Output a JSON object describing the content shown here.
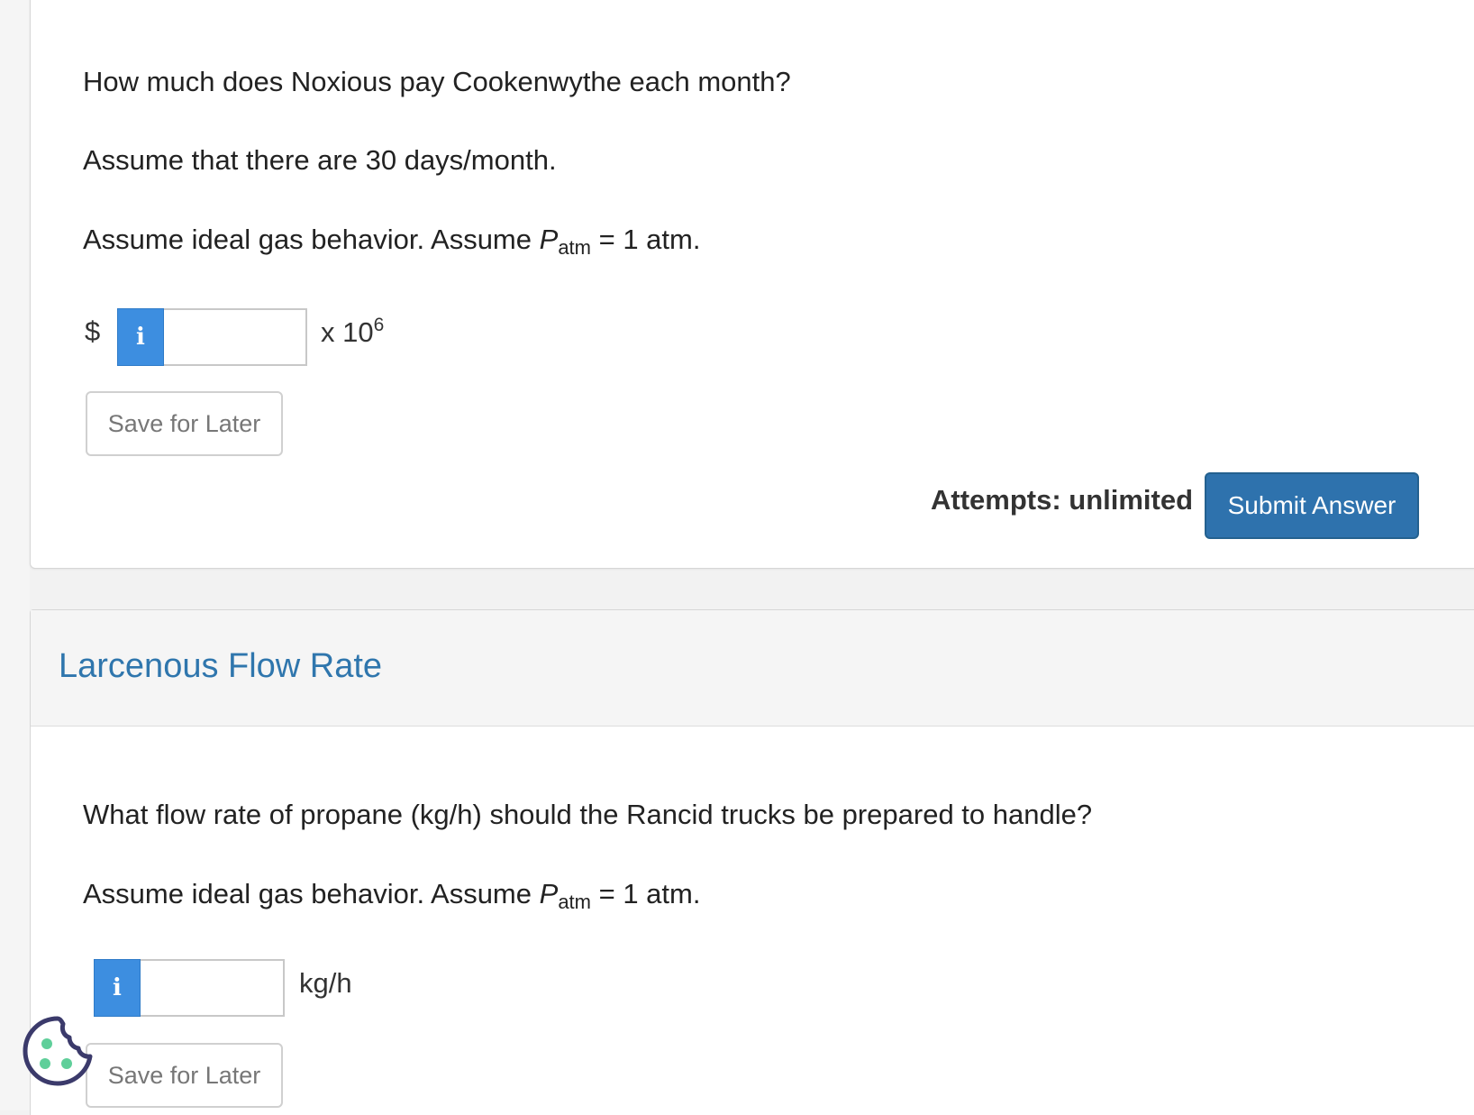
{
  "question1": {
    "prompt": "How much does Noxious pay Cookenwythe each month?",
    "assumption_days": "Assume that there are 30 days/month.",
    "assumption_gas_prefix": "Assume ideal gas behavior. Assume ",
    "p_symbol": "P",
    "p_subscript": "atm",
    "assumption_gas_suffix": " = 1 atm.",
    "currency_symbol": "$",
    "info_icon_glyph": "i",
    "answer_value": "",
    "unit_prefix": "x 10",
    "unit_exponent": "6",
    "save_label": "Save for Later",
    "attempts_label": "Attempts: unlimited",
    "submit_label": "Submit Answer"
  },
  "question2": {
    "section_title": "Larcenous Flow Rate",
    "prompt": "What flow rate of propane (kg/h) should the Rancid trucks be prepared to handle?",
    "assumption_gas_prefix": "Assume ideal gas behavior. Assume ",
    "p_symbol": "P",
    "p_subscript": "atm",
    "assumption_gas_suffix": " = 1 atm.",
    "info_icon_glyph": "i",
    "answer_value": "",
    "unit": "kg/h",
    "save_label": "Save for Later"
  },
  "icons": {
    "info": "info-icon",
    "cookie": "cookie-icon"
  },
  "colors": {
    "title_blue": "#2f76ad",
    "info_blue": "#3d8ee0",
    "submit_blue": "#2e72ad",
    "cookie_outline": "#3b3a6b",
    "cookie_dots": "#5fcf9a"
  }
}
